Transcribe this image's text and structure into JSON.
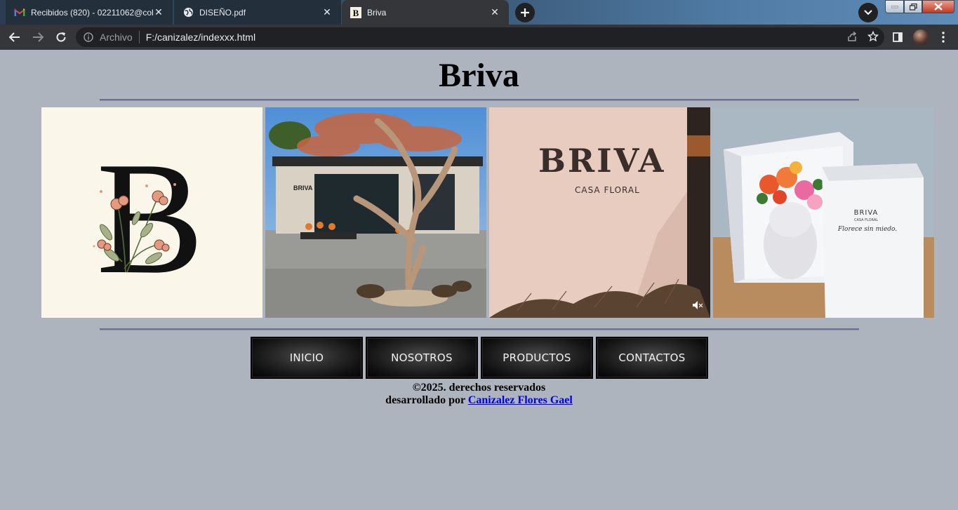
{
  "browser": {
    "tabs": [
      {
        "title": "Recibidos (820) - 02211062@cob",
        "favicon": "gmail-icon",
        "active": false
      },
      {
        "title": "DISEÑO.pdf",
        "favicon": "globe-icon",
        "active": false
      },
      {
        "title": "Briva",
        "favicon": "briva-b-icon",
        "active": true
      }
    ],
    "omnibox": {
      "security_chip": "Archivo",
      "url": "F:/canizalez/indexxx.html"
    }
  },
  "page": {
    "title": "Briva",
    "gallery": [
      {
        "name": "briva-logo-photo",
        "alt": "B"
      },
      {
        "name": "storefront-tree-photo",
        "alt": ""
      },
      {
        "name": "briva-wall-sign-photo",
        "sign_main": "BRIVA",
        "sign_sub": "CASA FLORAL"
      },
      {
        "name": "flower-box-photo",
        "box_brand": "BRIVA",
        "box_sub": "CASA FLORAL",
        "box_tagline": "Florece sin miedo."
      }
    ],
    "menu": [
      "INICIO",
      "NOSOTROS",
      "PRODUCTOS",
      "CONTACTOS"
    ],
    "footer": {
      "line1": "©2025. derechos reservados",
      "line2_prefix": "desarrollado por",
      "author_link": "Canizalez Flores Gael"
    }
  },
  "colors": {
    "page_bg": "#adb4bd",
    "rule": "#6b7193",
    "link": "#0000ee"
  }
}
